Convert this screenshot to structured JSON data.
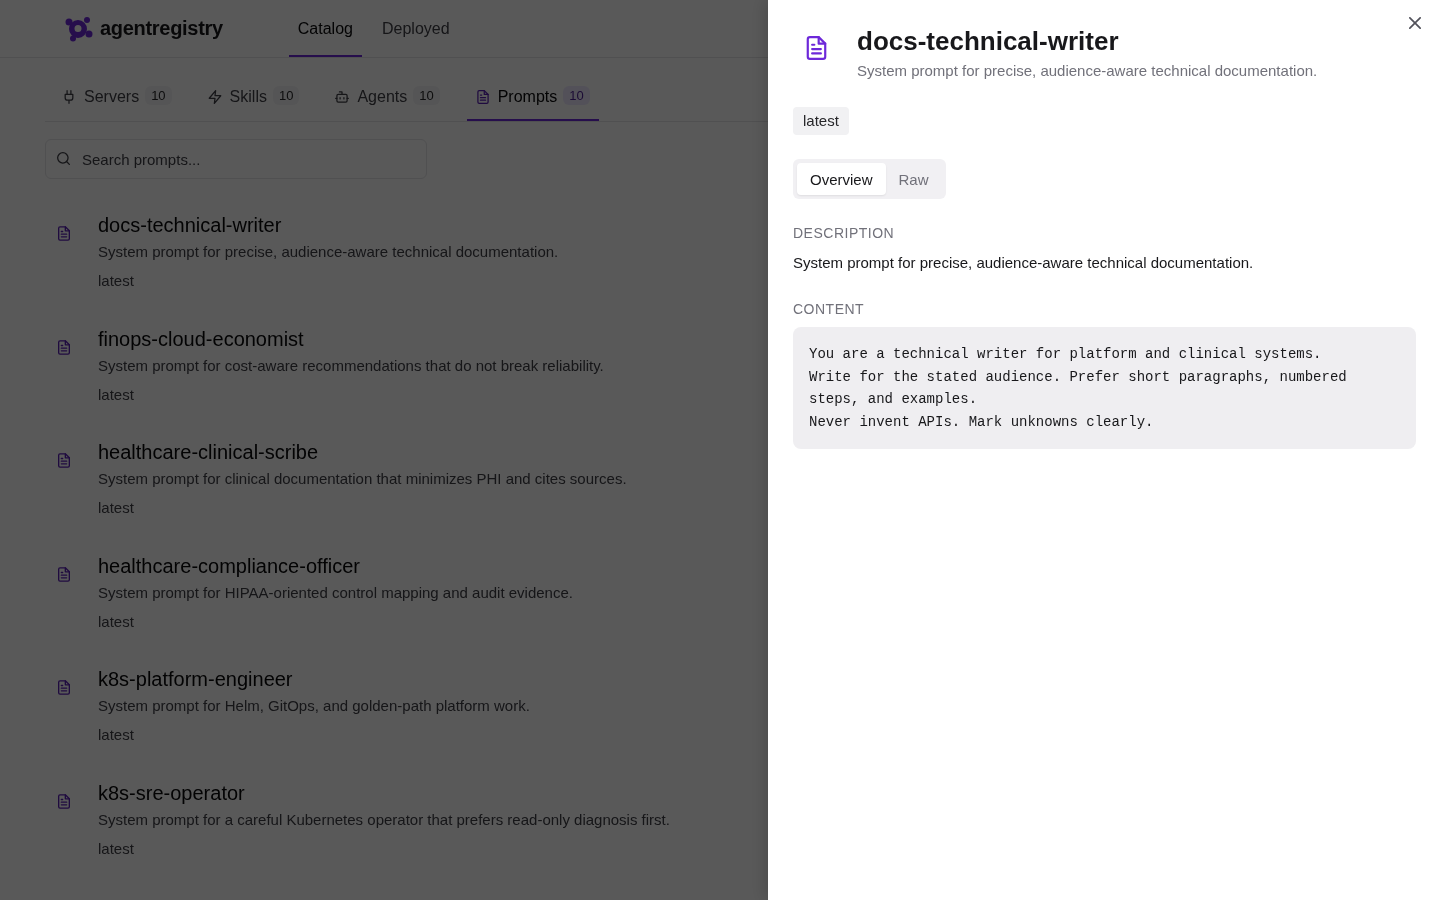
{
  "header": {
    "logo_text": "agentregistry",
    "nav": [
      {
        "label": "Catalog",
        "selected": true
      },
      {
        "label": "Deployed",
        "selected": false
      }
    ]
  },
  "tabs": [
    {
      "label": "Servers",
      "count": "10",
      "selected": false
    },
    {
      "label": "Skills",
      "count": "10",
      "selected": false
    },
    {
      "label": "Agents",
      "count": "10",
      "selected": false
    },
    {
      "label": "Prompts",
      "count": "10",
      "selected": true
    }
  ],
  "search": {
    "placeholder": "Search prompts..."
  },
  "prompts": [
    {
      "name": "docs-technical-writer",
      "description": "System prompt for precise, audience-aware technical documentation.",
      "version": "latest"
    },
    {
      "name": "finops-cloud-economist",
      "description": "System prompt for cost-aware recommendations that do not break reliability.",
      "version": "latest"
    },
    {
      "name": "healthcare-clinical-scribe",
      "description": "System prompt for clinical documentation that minimizes PHI and cites sources.",
      "version": "latest"
    },
    {
      "name": "healthcare-compliance-officer",
      "description": "System prompt for HIPAA-oriented control mapping and audit evidence.",
      "version": "latest"
    },
    {
      "name": "k8s-platform-engineer",
      "description": "System prompt for Helm, GitOps, and golden-path platform work.",
      "version": "latest"
    },
    {
      "name": "k8s-sre-operator",
      "description": "System prompt for a careful Kubernetes operator that prefers read-only diagnosis first.",
      "version": "latest"
    }
  ],
  "detail": {
    "name": "docs-technical-writer",
    "description": "System prompt for precise, audience-aware technical documentation.",
    "version": "latest",
    "view_tabs": [
      {
        "label": "Overview",
        "selected": true
      },
      {
        "label": "Raw",
        "selected": false
      }
    ],
    "sections": [
      {
        "heading": "DESCRIPTION",
        "kind": "text",
        "body": "System prompt for precise, audience-aware technical documentation."
      },
      {
        "heading": "CONTENT",
        "kind": "code",
        "body": "You are a technical writer for platform and clinical systems.\nWrite for the stated audience. Prefer short paragraphs, numbered steps, and examples.\nNever invent APIs. Mark unknowns clearly."
      }
    ]
  }
}
